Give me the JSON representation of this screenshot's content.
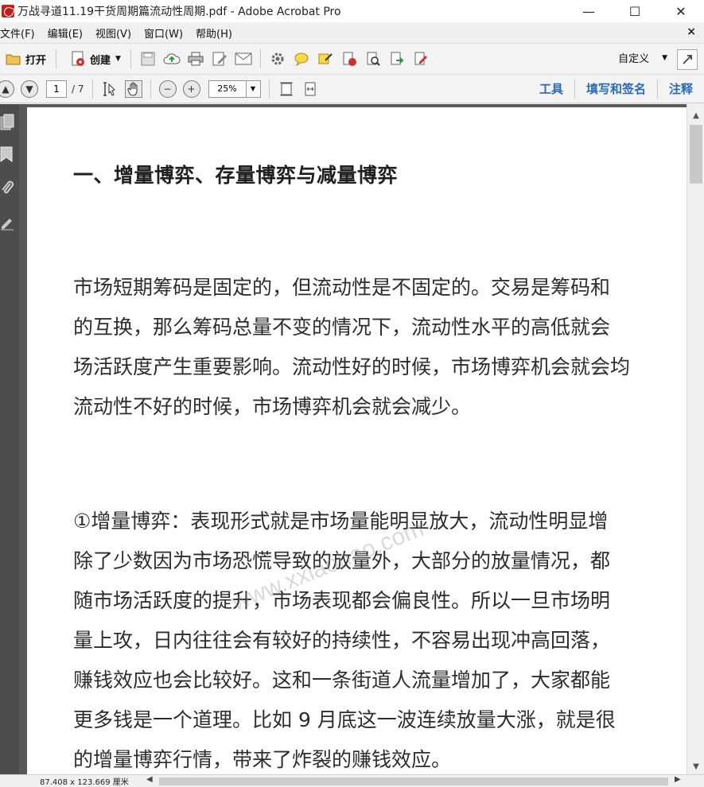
{
  "window": {
    "title": "万战寻道11.19干货周期篇流动性周期.pdf - Adobe Acrobat Pro",
    "minimize": "—",
    "maximize": "☐",
    "close": "✕"
  },
  "menu": {
    "items": [
      "文件(F)",
      "编辑(E)",
      "视图(V)",
      "窗口(W)",
      "帮助(H)"
    ],
    "close": "×"
  },
  "toolbar1": {
    "open_label": "打开",
    "create_label": "创建",
    "custom_label": "自定义"
  },
  "toolbar2": {
    "page_current": "1",
    "page_total": "/ 7",
    "zoom": "25%",
    "links": [
      "工具",
      "填写和签名",
      "注释"
    ]
  },
  "document": {
    "heading": "一、增量博弈、存量博弈与减量博弈",
    "paragraph1": [
      "市场短期筹码是固定的，但流动性是不固定的。交易是筹码和",
      "的互换，那么筹码总量不变的情况下，流动性水平的高低就会",
      "场活跃度产生重要影响。流动性好的时候，市场博弈机会就会均",
      "流动性不好的时候，市场博弈机会就会减少。"
    ],
    "paragraph2": [
      "①增量博弈：表现形式就是市场量能明显放大，流动性明显增",
      "除了少数因为市场恐慌导致的放量外，大部分的放量情况，都",
      "随市场活跃度的提升，市场表现都会偏良性。所以一旦市场明",
      "量上攻，日内往往会有较好的持续性，不容易出现冲高回落，",
      "赚钱效应也会比较好。这和一条街道人流量增加了，大家都能",
      "更多钱是一个道理。比如 9 月底这一波连续放量大涨，就是很",
      "的增量博弈行情，带来了炸裂的赚钱效应。"
    ],
    "watermark": "www.xxiaohao.com"
  },
  "status": {
    "page_size": "87.408 x 123.669 厘米"
  }
}
